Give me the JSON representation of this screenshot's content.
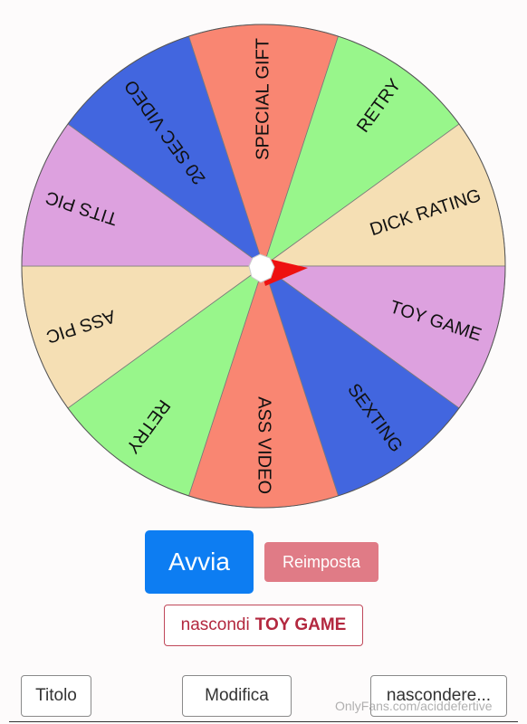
{
  "wheel": {
    "segments": [
      {
        "label": "SPECIAL GIFT",
        "color": "#f98672"
      },
      {
        "label": "RETRY",
        "color": "#98f68b"
      },
      {
        "label": "DICK RATING",
        "color": "#f5dfb4"
      },
      {
        "label": "TOY GAME",
        "color": "#dda1df"
      },
      {
        "label": "SEXTING",
        "color": "#4266df"
      },
      {
        "label": "ASS VIDEO",
        "color": "#f98672"
      },
      {
        "label": "RETRY",
        "color": "#98f68b"
      },
      {
        "label": "ASS PIC",
        "color": "#f5dfb4"
      },
      {
        "label": "TITS PIC",
        "color": "#dda1df"
      },
      {
        "label": "20 SEC VIDEO",
        "color": "#4266df"
      }
    ],
    "pointer_color": "#ee1111"
  },
  "controls": {
    "spin_label": "Avvia",
    "reset_label": "Reimposta",
    "hide_prefix": "nascondi",
    "hide_target": "TOY GAME"
  },
  "toolbar": {
    "title_label": "Titolo",
    "edit_label": "Modifica",
    "hide_more_label": "nascondere..."
  },
  "watermark": "OnlyFans.com/aciddefertive"
}
